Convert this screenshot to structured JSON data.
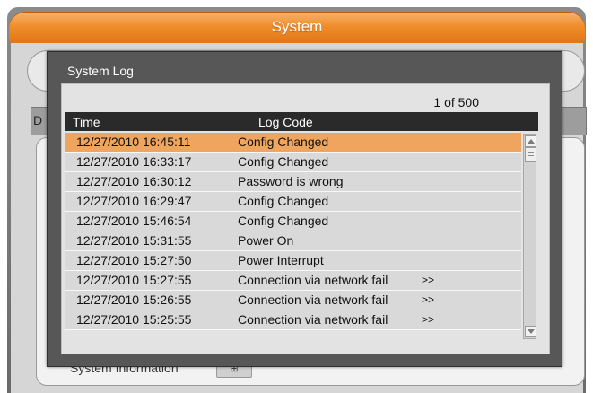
{
  "window": {
    "title": "System"
  },
  "background": {
    "header_letter": "D",
    "system_information_label": "System Information",
    "system_information_button": "⊞"
  },
  "dialog": {
    "title": "System Log",
    "page_counter": "1 of 500",
    "columns": [
      "Time",
      "Log Code"
    ],
    "rows": [
      {
        "time": "12/27/2010 16:45:11",
        "code": "Config Changed",
        "more": ""
      },
      {
        "time": "12/27/2010 16:33:17",
        "code": "Config Changed",
        "more": ""
      },
      {
        "time": "12/27/2010 16:30:12",
        "code": "Password is wrong",
        "more": ""
      },
      {
        "time": "12/27/2010 16:29:47",
        "code": "Config Changed",
        "more": ""
      },
      {
        "time": "12/27/2010 15:46:54",
        "code": "Config Changed",
        "more": ""
      },
      {
        "time": "12/27/2010 15:31:55",
        "code": "Power On",
        "more": ""
      },
      {
        "time": "12/27/2010 15:27:50",
        "code": "Power Interrupt",
        "more": ""
      },
      {
        "time": "12/27/2010 15:27:55",
        "code": "Connection via network fail",
        "more": ">>"
      },
      {
        "time": "12/27/2010 15:26:55",
        "code": "Connection via network fail",
        "more": ">>"
      },
      {
        "time": "12/27/2010 15:25:55",
        "code": "Connection via network fail",
        "more": ">>"
      }
    ],
    "selected_row": 0
  },
  "colors": {
    "title_bar": "#ef8e2c",
    "selected_row": "#f0a55e",
    "dialog_bg": "#575757",
    "table_header": "#2a2a2a"
  },
  "icons": {
    "scroll_up": "scroll-up-arrow-icon",
    "scroll_down": "scroll-down-arrow-icon",
    "scroll_thumb": "scroll-thumb-grip-icon"
  }
}
